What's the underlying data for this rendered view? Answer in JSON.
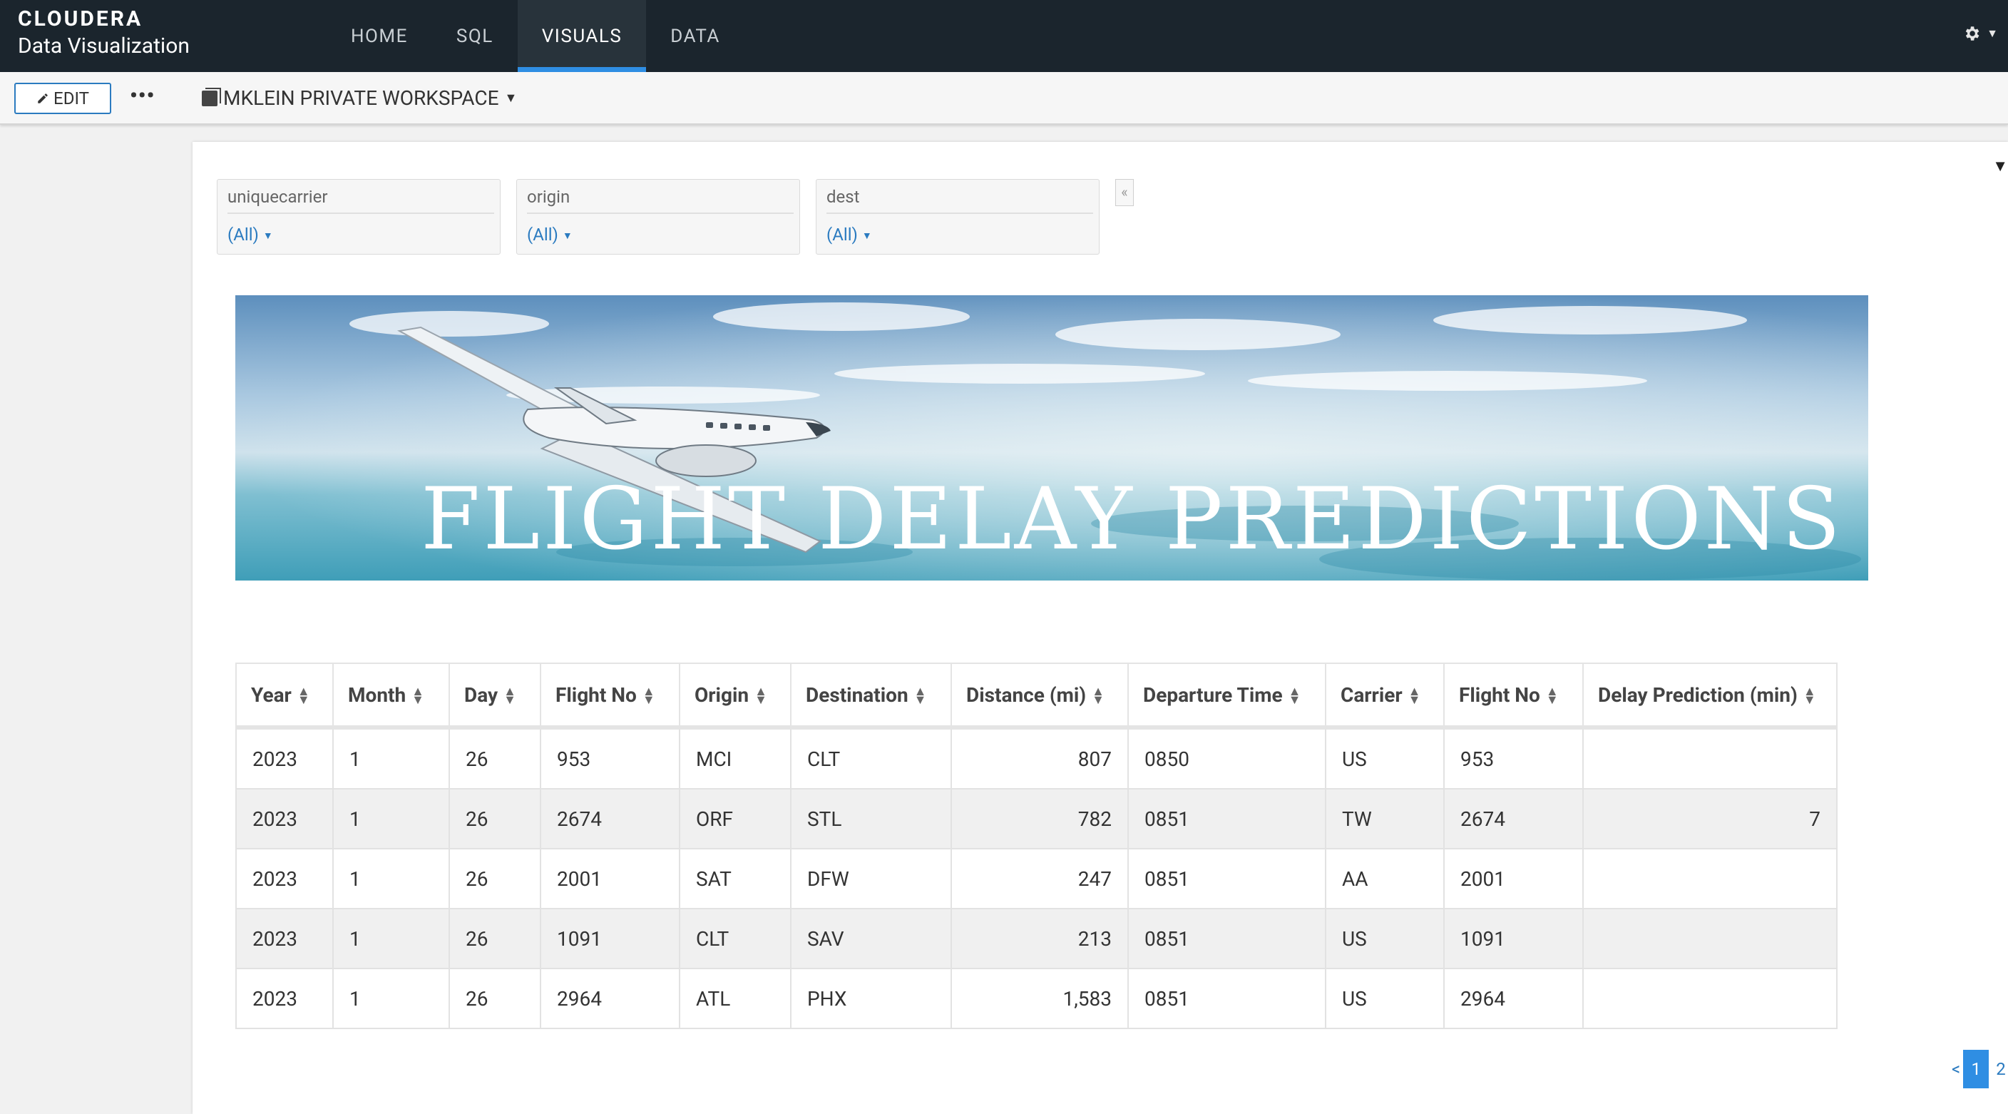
{
  "brand": {
    "line1": "CLOUDERA",
    "line2": "Data Visualization"
  },
  "nav": {
    "items": [
      {
        "label": "HOME"
      },
      {
        "label": "SQL"
      },
      {
        "label": "VISUALS"
      },
      {
        "label": "DATA"
      }
    ],
    "active": "VISUALS"
  },
  "toolbar": {
    "edit_label": "EDIT",
    "more_label": "•••",
    "workspace_label": "MKLEIN PRIVATE WORKSPACE"
  },
  "filters": [
    {
      "label": "uniquecarrier",
      "value": "(All)"
    },
    {
      "label": "origin",
      "value": "(All)"
    },
    {
      "label": "dest",
      "value": "(All)"
    }
  ],
  "collapse_glyph": "«",
  "banner": {
    "title": "FLIGHT DELAY PREDICTIONS"
  },
  "table": {
    "columns": [
      "Year",
      "Month",
      "Day",
      "Flight No",
      "Origin",
      "Destination",
      "Distance (mi)",
      "Departure Time",
      "Carrier",
      "Flight No",
      "Delay Prediction (min)"
    ],
    "rows": [
      [
        "2023",
        "1",
        "26",
        "953",
        "MCI",
        "CLT",
        "807",
        "0850",
        "US",
        "953",
        ""
      ],
      [
        "2023",
        "1",
        "26",
        "2674",
        "ORF",
        "STL",
        "782",
        "0851",
        "TW",
        "2674",
        "7"
      ],
      [
        "2023",
        "1",
        "26",
        "2001",
        "SAT",
        "DFW",
        "247",
        "0851",
        "AA",
        "2001",
        ""
      ],
      [
        "2023",
        "1",
        "26",
        "1091",
        "CLT",
        "SAV",
        "213",
        "0851",
        "US",
        "1091",
        ""
      ],
      [
        "2023",
        "1",
        "26",
        "2964",
        "ATL",
        "PHX",
        "1,583",
        "0851",
        "US",
        "2964",
        ""
      ]
    ]
  },
  "pagination": {
    "prev": "<",
    "pages": [
      "1",
      "2"
    ],
    "current": "1"
  },
  "colors": {
    "topbar": "#1b252d",
    "accent": "#2f8ee3",
    "link": "#2b7bc0"
  }
}
